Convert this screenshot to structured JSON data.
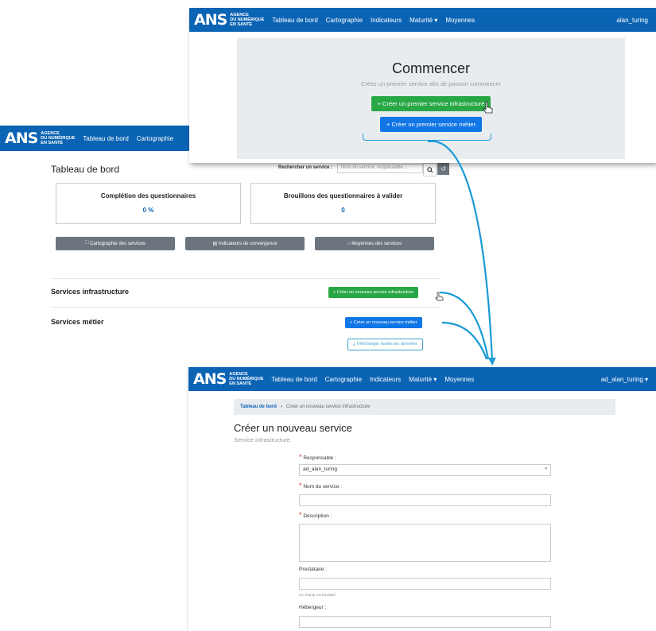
{
  "brand": {
    "mark": "ANS",
    "line1": "AGENCE",
    "line2": "DU NUMÉRIQUE",
    "line3": "EN SANTÉ"
  },
  "panel_a": {
    "nav": [
      "Tableau de bord",
      "Cartographie",
      "Indicateurs",
      "Maturité ▾",
      "Moyennes"
    ],
    "user": "alan_turing",
    "title": "Commencer",
    "subtitle": "Créez un premier service afin de pouvoir commencer",
    "btn_infra": "+ Créer un premier service infrastructure",
    "btn_metier": "+ Créer un premier service métier"
  },
  "panel_b": {
    "nav": [
      "Tableau de bord",
      "Cartographie"
    ],
    "page_title": "Tableau de bord",
    "search_label": "Rechercher un service :",
    "search_placeholder": "Nom du service, responsable ...",
    "search_icon": "search-icon",
    "stats": [
      {
        "label": "Complétion des questionnaires",
        "value": "0 %"
      },
      {
        "label": "Brouillons des questionnaires à valider",
        "value": "0"
      }
    ],
    "buttons": [
      "Cartographie des services",
      "Indicateurs de convergence",
      "Moyennes des services"
    ],
    "section_infra": "Services infrastructure",
    "section_metier": "Services métier",
    "btn_new_infra": "+ Créer un nouveau service infrastructure",
    "btn_new_metier": "+ Créer un nouveau service métier",
    "btn_download": "Télécharger toutes les données"
  },
  "panel_c": {
    "nav": [
      "Tableau de bord",
      "Cartographie",
      "Indicateurs",
      "Maturité ▾",
      "Moyennes"
    ],
    "user": "ad_alan_turing ▾",
    "breadcrumb_home": "Tableau de bord",
    "breadcrumb_current": "Créer un nouveau service infrastructure",
    "title": "Créer un nouveau service",
    "subtitle": "Service infrastructure",
    "labels": {
      "responsable": "Responsable :",
      "nom": "Nom du service :",
      "description": "Description :",
      "prestataire": "Prestataire :",
      "hint": "Ce champ est facultatif",
      "hebergeur": "Hébergeur :"
    },
    "responsable_value": "ad_alan_turing"
  },
  "colors": {
    "nav": "#0b63b4",
    "green": "#28a745",
    "blue": "#1176e6",
    "arrow": "#1a9ad6"
  }
}
